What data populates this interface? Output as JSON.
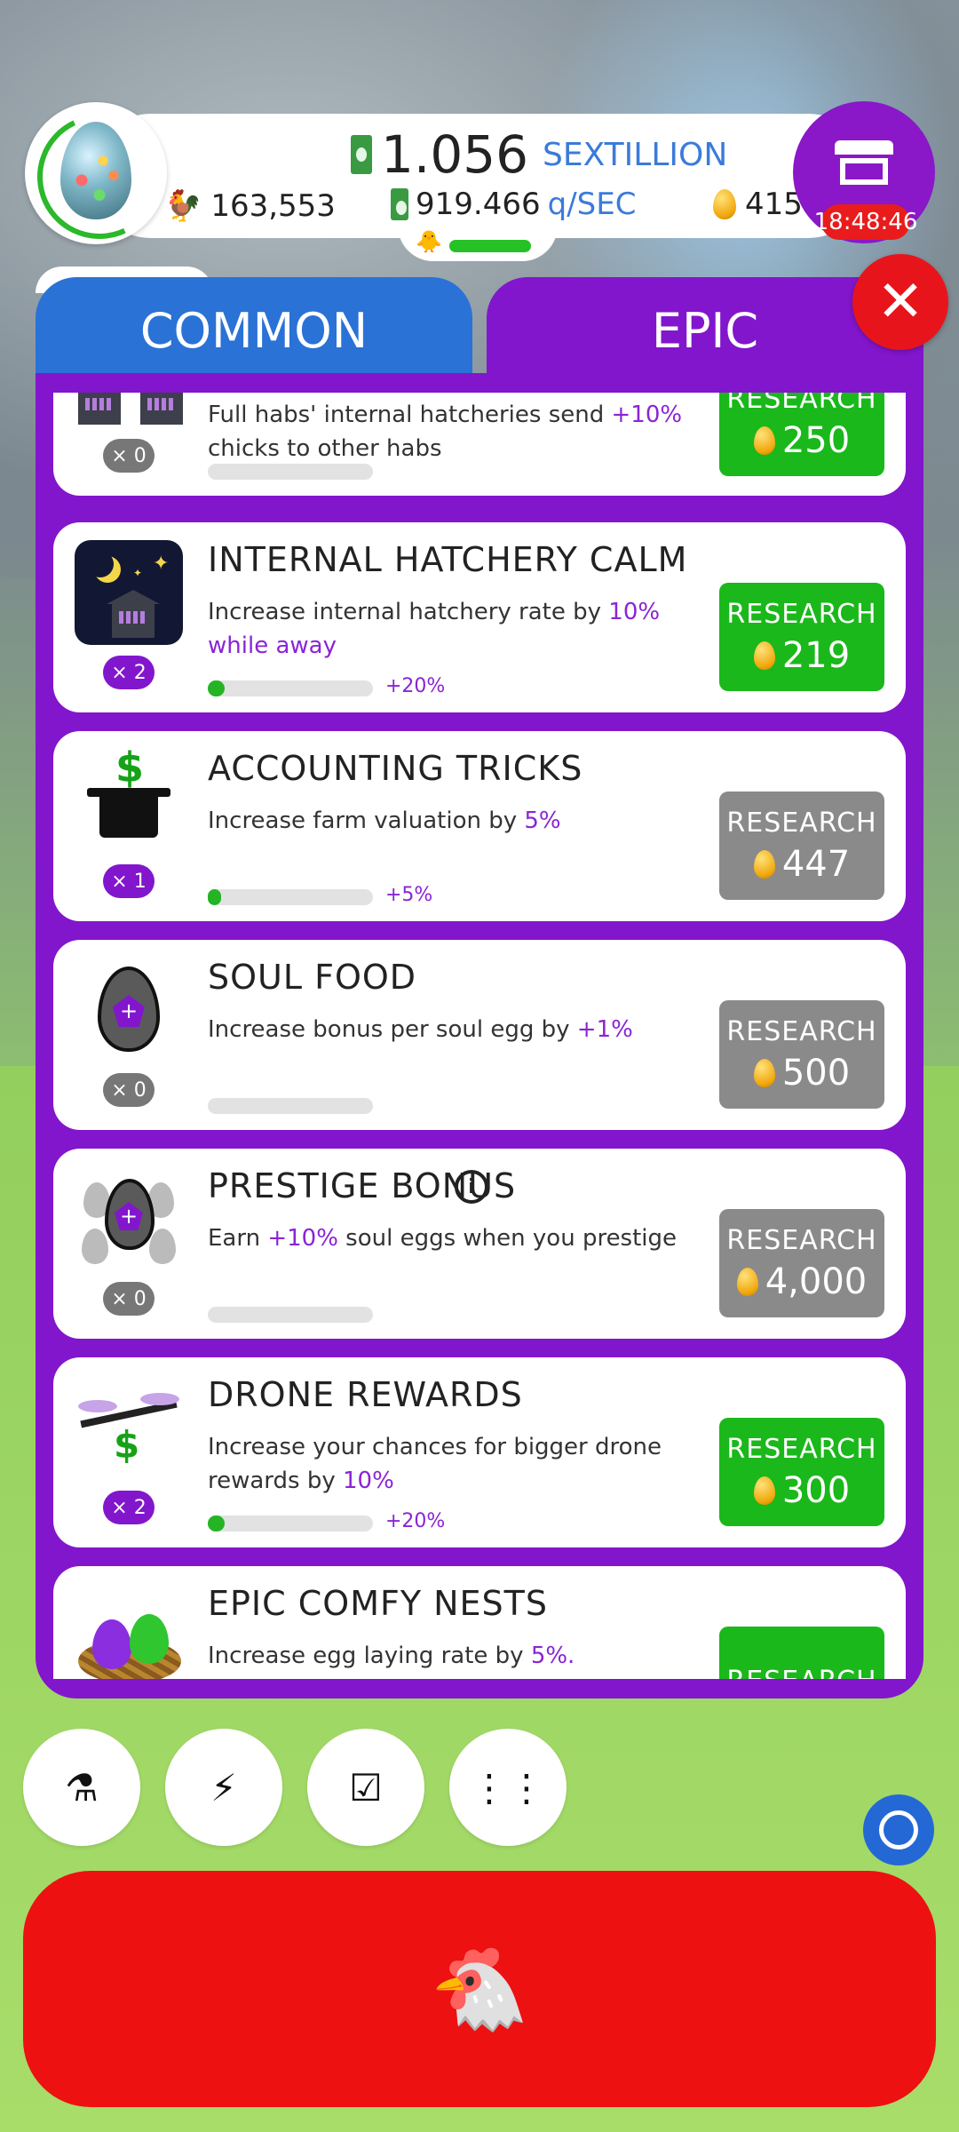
{
  "header": {
    "money_value": "1.056",
    "money_unit": "SEXTILLION",
    "rate_value": "919.466",
    "rate_unit": "q/SEC",
    "chicken_count": "163,553",
    "golden_eggs": "415",
    "shop_timer": "18:48:46"
  },
  "tabs": [
    {
      "label": "COMMON"
    },
    {
      "label": "EPIC"
    }
  ],
  "research_items": [
    {
      "title": "",
      "desc_a": "Full habs' internal hatcheries send ",
      "desc_hl": "+10%",
      "desc_b": " chicks to other habs",
      "level": "× 0",
      "progress_label": "",
      "button_label": "RESEARCH",
      "cost": "250",
      "state": "available",
      "progress": 0
    },
    {
      "title": "INTERNAL HATCHERY CALM",
      "desc_a": "Increase internal hatchery rate by ",
      "desc_hl": "10% while away",
      "desc_b": "",
      "level": "× 2",
      "progress_label": "+20%",
      "button_label": "RESEARCH",
      "cost": "219",
      "state": "available",
      "progress": 0.1
    },
    {
      "title": "ACCOUNTING TRICKS",
      "desc_a": "Increase farm valuation by ",
      "desc_hl": "5%",
      "desc_b": "",
      "level": "× 1",
      "progress_label": "+5%",
      "button_label": "RESEARCH",
      "cost": "447",
      "state": "locked",
      "progress": 0.05
    },
    {
      "title": "SOUL FOOD",
      "desc_a": "Increase bonus per soul egg by ",
      "desc_hl": "+1%",
      "desc_b": "",
      "level": "× 0",
      "progress_label": "",
      "button_label": "RESEARCH",
      "cost": "500",
      "state": "locked",
      "progress": 0
    },
    {
      "title": "PRESTIGE BONUS",
      "desc_a": "Earn ",
      "desc_hl": "+10%",
      "desc_b": " soul eggs when you prestige",
      "level": "× 0",
      "progress_label": "",
      "button_label": "RESEARCH",
      "cost": "4,000",
      "state": "locked",
      "progress": 0
    },
    {
      "title": "DRONE REWARDS",
      "desc_a": "Increase your chances for bigger drone rewards by ",
      "desc_hl": "10%",
      "desc_b": "",
      "level": "× 2",
      "progress_label": "+20%",
      "button_label": "RESEARCH",
      "cost": "300",
      "state": "available",
      "progress": 0.1
    },
    {
      "title": "EPIC COMFY NESTS",
      "desc_a": "Increase egg laying rate by ",
      "desc_hl": "5%.",
      "desc_b": "",
      "level": "",
      "progress_label": "",
      "button_label": "RESEARCH",
      "cost": "",
      "state": "available",
      "progress": 0
    }
  ],
  "bottom_bar": {
    "buttons": [
      {
        "icon": "flask-icon",
        "glyph": "⚗"
      },
      {
        "icon": "lightning-icon",
        "glyph": "⚡"
      },
      {
        "icon": "checklist-icon",
        "glyph": "☑"
      },
      {
        "icon": "grid-icon",
        "glyph": "⋮⋮"
      }
    ],
    "hatch_glyph": "🐔"
  },
  "colors": {
    "epic_purple": "#8216cc",
    "common_blue": "#2a72d6",
    "research_green": "#1ab81a",
    "research_gray": "#8a8a8a",
    "hatch_red": "#ed1111"
  }
}
